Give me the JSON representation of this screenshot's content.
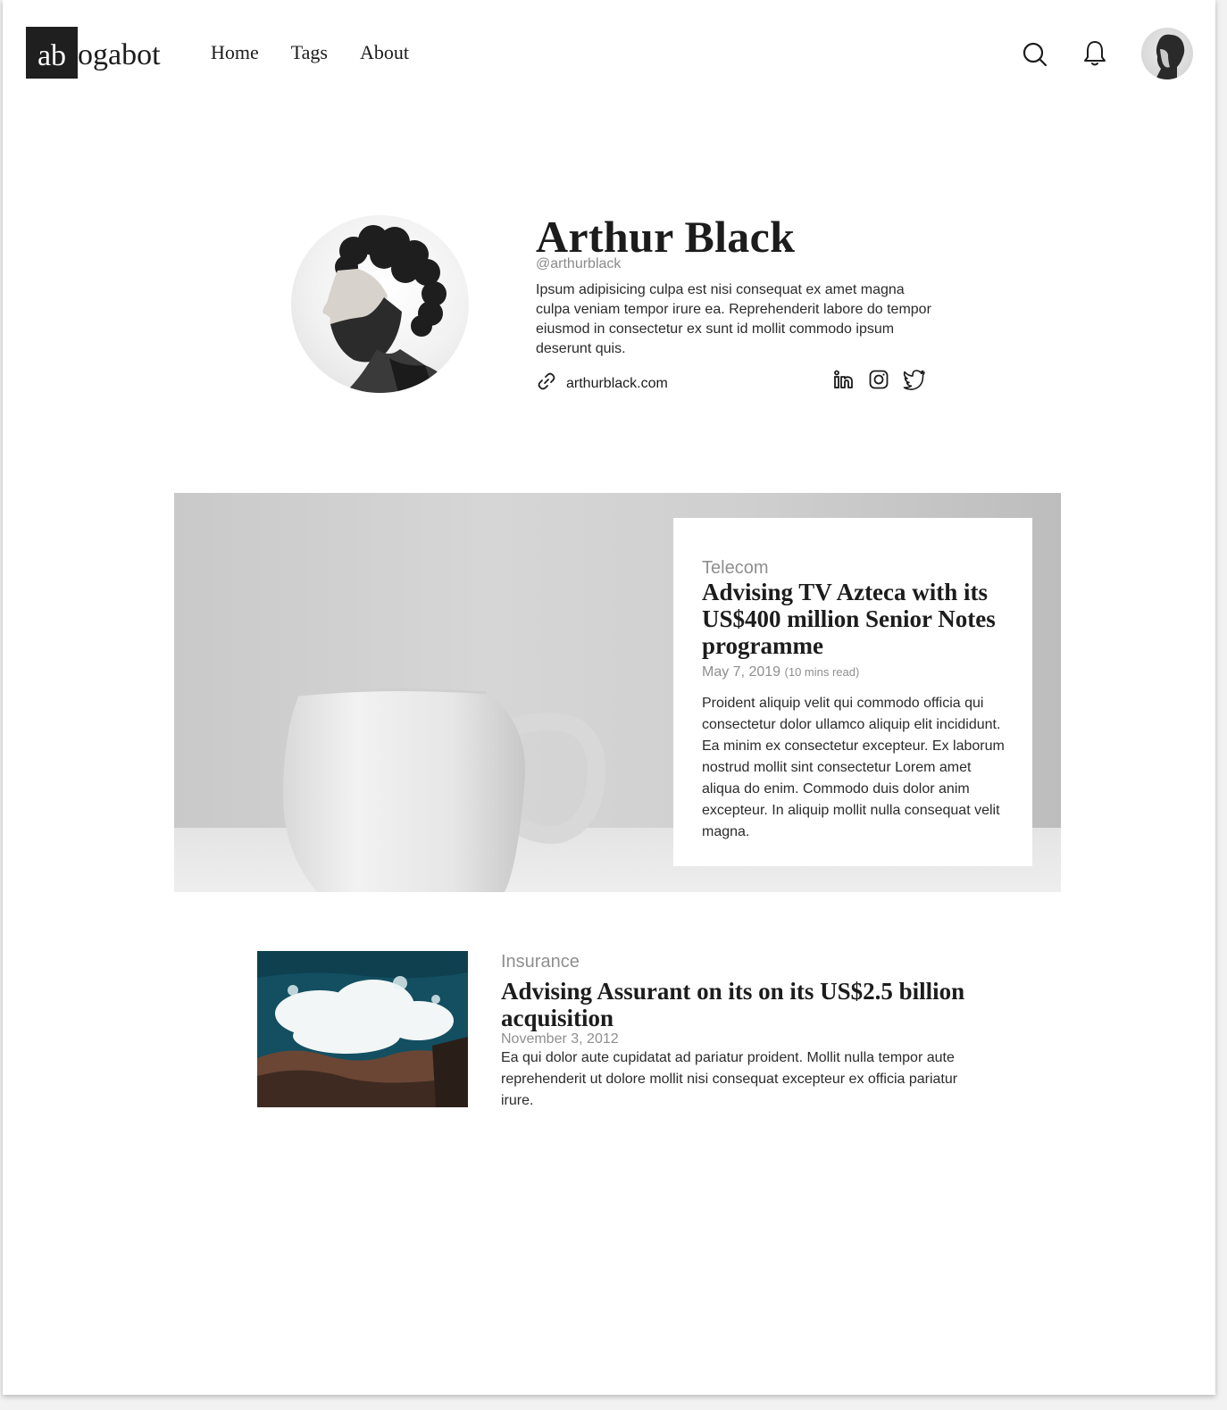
{
  "header": {
    "logo_box": "ab",
    "logo_rest": "ogabot",
    "nav": [
      "Home",
      "Tags",
      "About"
    ],
    "search_icon": "search-icon",
    "bell_icon": "bell-icon"
  },
  "profile": {
    "name": "Arthur Black",
    "handle": "@arthurblack",
    "bio": "Ipsum adipisicing culpa est nisi consequat ex amet magna culpa veniam tempor irure ea. Reprehenderit labore do tempor eiusmod in consectetur ex sunt id mollit commodo ipsum deserunt quis.",
    "website": "arthurblack.com",
    "socials": [
      "linkedin-icon",
      "instagram-icon",
      "twitter-icon"
    ]
  },
  "featured": {
    "category": "Telecom",
    "title": "Advising TV Azteca with its US$400 million Senior Notes programme",
    "date": "May 7, 2019",
    "read_time": "(10 mins read)",
    "excerpt": "Proident aliquip velit qui commodo officia qui consectetur dolor ullamco aliquip elit incididunt. Ea minim ex consectetur excepteur. Ex laborum nostrud mollit sint consectetur Lorem amet aliqua do enim. Commodo duis dolor anim excepteur. In aliquip mollit nulla consequat velit magna."
  },
  "articles": [
    {
      "category": "Insurance",
      "title": "Advising Assurant on its on its US$2.5 billion acquisition",
      "date": "November 3, 2012",
      "excerpt": "Ea qui dolor aute cupidatat ad pariatur proident. Mollit nulla tempor aute reprehenderit ut dolore mollit nisi consequat excepteur ex officia pariatur irure."
    }
  ],
  "colors": {
    "text": "#1c1c1c",
    "muted": "#8f8f8f",
    "logo_box": "#1f1f1f"
  }
}
